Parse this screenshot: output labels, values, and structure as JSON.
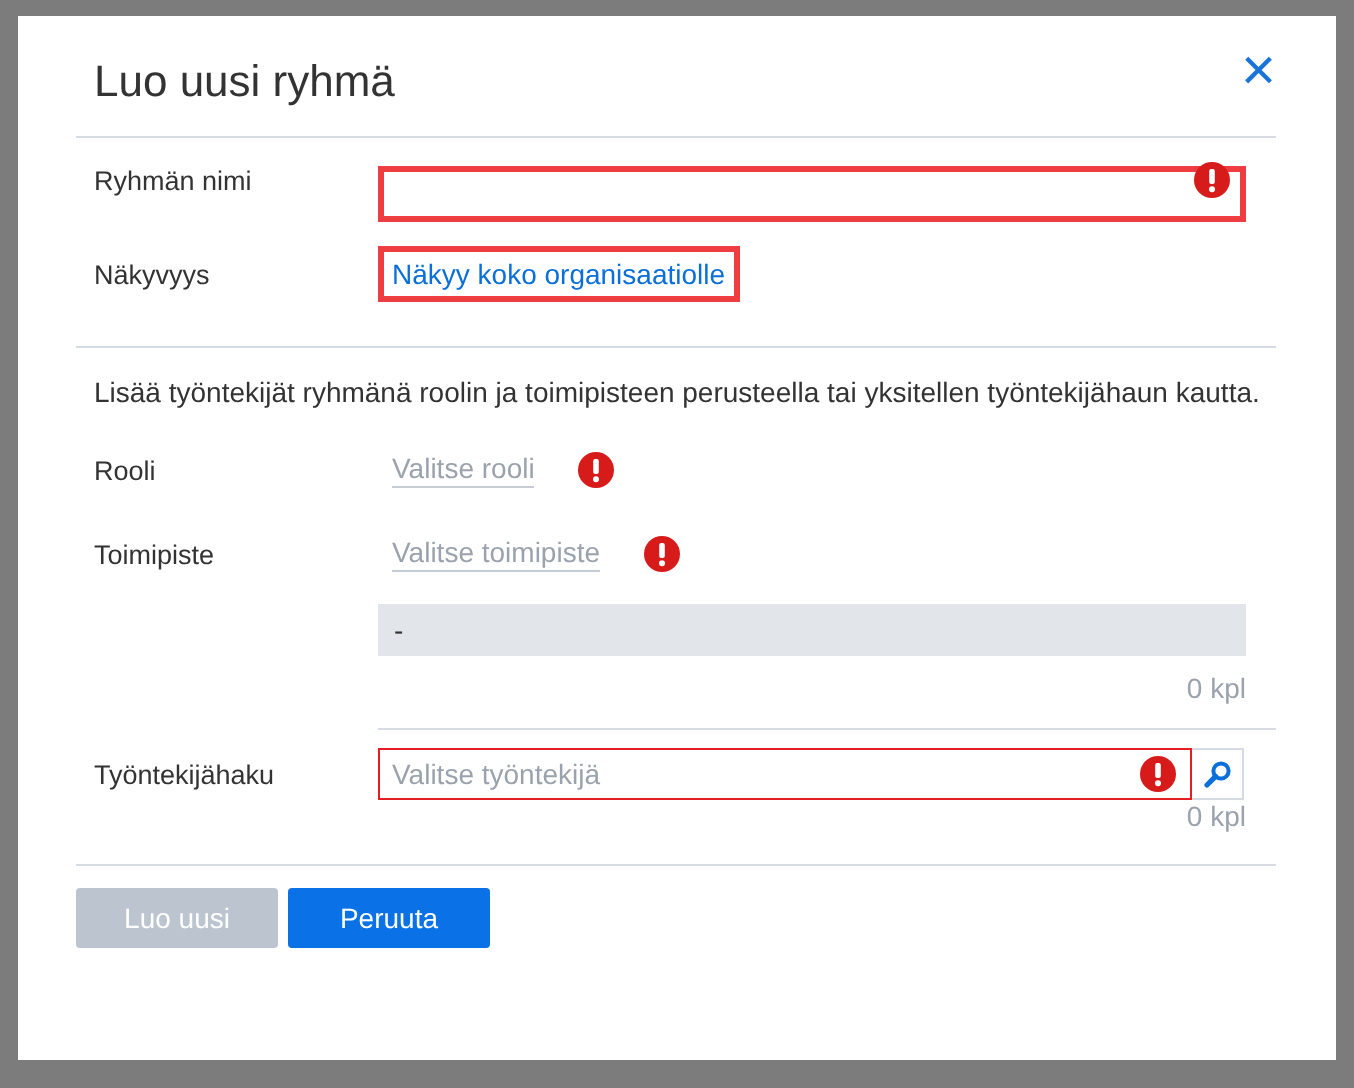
{
  "dialog": {
    "title": "Luo uusi ryhmä",
    "close": "×"
  },
  "name_field": {
    "label": "Ryhmän nimi",
    "error": true
  },
  "visibility": {
    "label": "Näkyvyys",
    "link": "Näkyy koko organisaatiolle",
    "highlighted": true
  },
  "description": "Lisää työntekijät ryhmänä roolin ja toimipisteen perusteella tai yksitellen työntekijähaun kautta.",
  "selects": [
    {
      "label": "Rooli",
      "placeholder": "Valitse rooli",
      "error": true
    },
    {
      "label": "Toimipiste",
      "placeholder": "Valitse toimipiste",
      "error": true
    }
  ],
  "location_list": {
    "items": [
      "-"
    ],
    "count": "0 kpl"
  },
  "employee_search": {
    "label": "Työntekijähaku",
    "placeholder": "Valitse työntekijä",
    "error": true,
    "count": "0 kpl"
  },
  "buttons": [
    {
      "label": "Luo uusi",
      "disabled": true
    },
    {
      "label": "Peruuta",
      "disabled": false
    }
  ]
}
